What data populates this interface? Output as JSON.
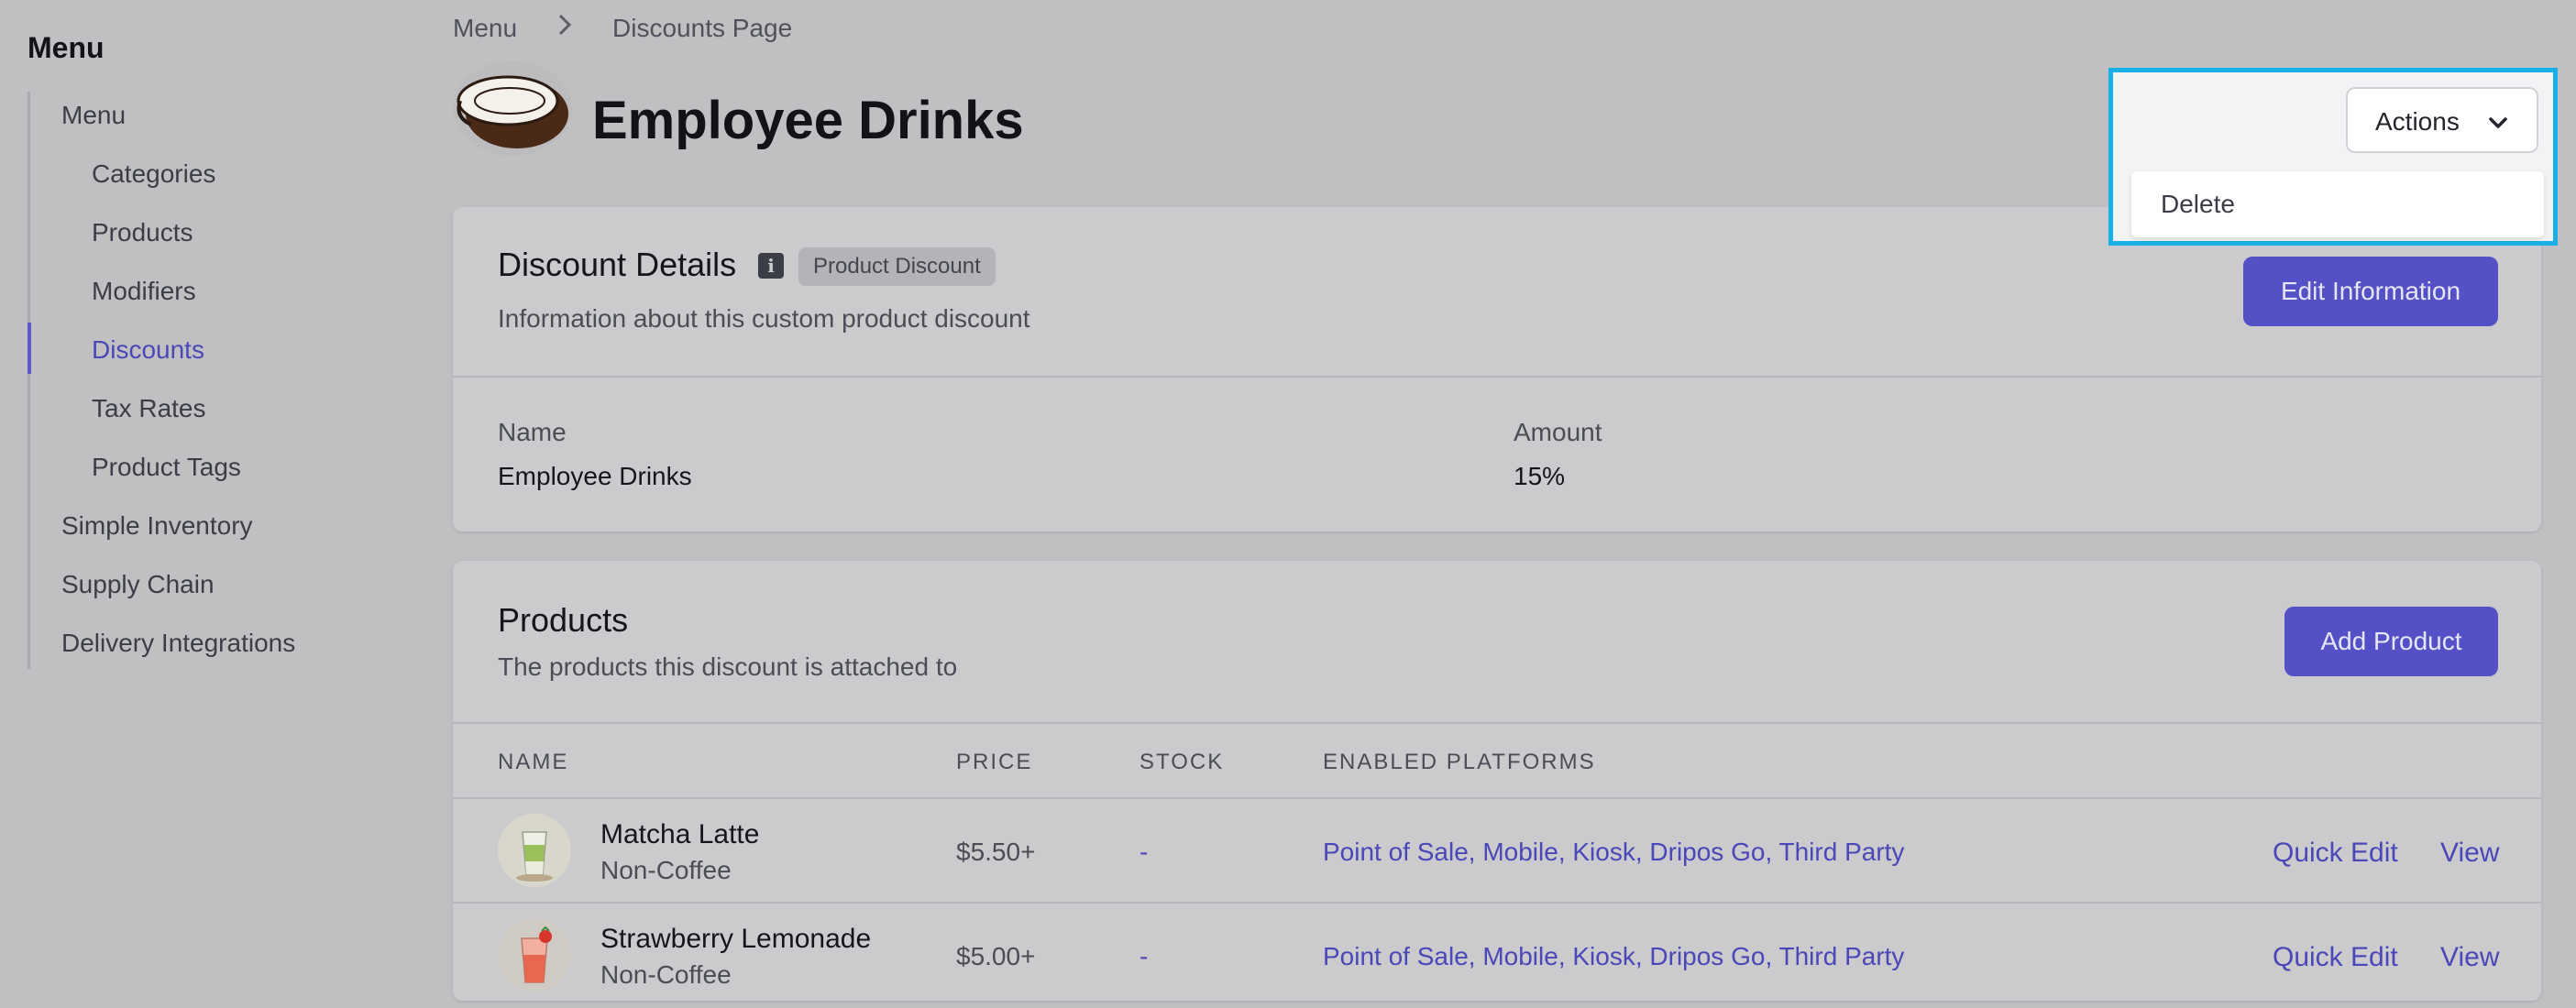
{
  "sidebar": {
    "title": "Menu",
    "items": [
      {
        "label": "Menu"
      },
      {
        "label": "Categories"
      },
      {
        "label": "Products"
      },
      {
        "label": "Modifiers"
      },
      {
        "label": "Discounts"
      },
      {
        "label": "Tax Rates"
      },
      {
        "label": "Product Tags"
      },
      {
        "label": "Simple Inventory"
      },
      {
        "label": "Supply Chain"
      },
      {
        "label": "Delivery Integrations"
      }
    ],
    "active_item": "Discounts"
  },
  "breadcrumb": [
    "Menu",
    "Discounts Page"
  ],
  "header": {
    "title": "Employee Drinks",
    "actions_label": "Actions",
    "actions_menu": [
      "Delete"
    ]
  },
  "details": {
    "title": "Discount Details",
    "badge": "Product Discount",
    "subtitle": "Information about this custom product discount",
    "edit_button": "Edit Information",
    "fields": [
      {
        "label": "Name",
        "value": "Employee Drinks"
      },
      {
        "label": "Amount",
        "value": "15%"
      }
    ]
  },
  "products": {
    "title": "Products",
    "subtitle": "The products this discount is attached to",
    "add_button": "Add Product",
    "columns": [
      "NAME",
      "PRICE",
      "STOCK",
      "ENABLED PLATFORMS"
    ],
    "rows": [
      {
        "name": "Matcha Latte",
        "category": "Non-Coffee",
        "price": "$5.50+",
        "stock": "-",
        "platforms": "Point of Sale, Mobile, Kiosk, Dripos Go, Third Party",
        "quick_edit": "Quick Edit",
        "view": "View"
      },
      {
        "name": "Strawberry Lemonade",
        "category": "Non-Coffee",
        "price": "$5.00+",
        "stock": "-",
        "platforms": "Point of Sale, Mobile, Kiosk, Dripos Go, Third Party",
        "quick_edit": "Quick Edit",
        "view": "View"
      }
    ]
  },
  "colors": {
    "accent": "#5451c6",
    "link": "#4a47b8",
    "focus_outline": "#17b0e6"
  },
  "icons": {
    "breadcrumb_separator": "chevron-right-icon",
    "details_info": "info-icon",
    "actions_dropdown": "chevron-down-icon",
    "header_image": "coffee-cup-icon"
  }
}
